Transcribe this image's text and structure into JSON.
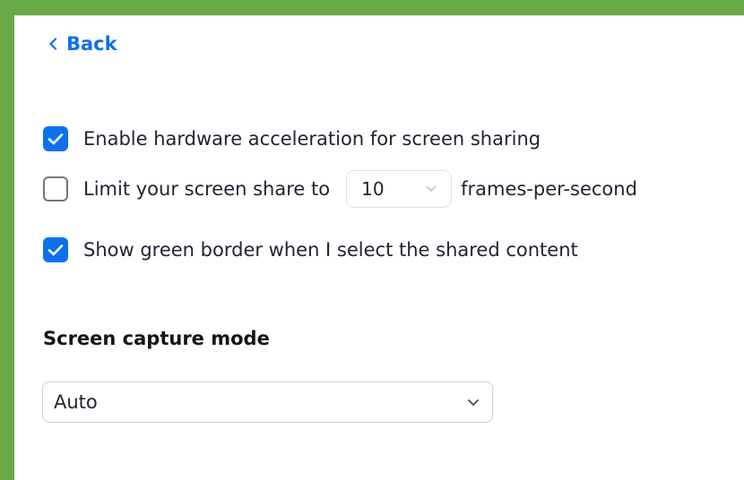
{
  "colors": {
    "focus_border": "#6aa948",
    "accent": "#0e71eb",
    "text": "#232333"
  },
  "back": {
    "label": "Back",
    "icon": "chevron-left-icon"
  },
  "options": {
    "hardware_acceleration": {
      "label": "Enable hardware acceleration for screen sharing",
      "checked": true
    },
    "limit_fps": {
      "label_before": "Limit your screen share to",
      "fps_value": "10",
      "label_after": "frames-per-second",
      "checked": false
    },
    "green_border": {
      "label": "Show green border when I select the shared content",
      "checked": true
    }
  },
  "capture_mode": {
    "title": "Screen capture mode",
    "selected": "Auto"
  }
}
